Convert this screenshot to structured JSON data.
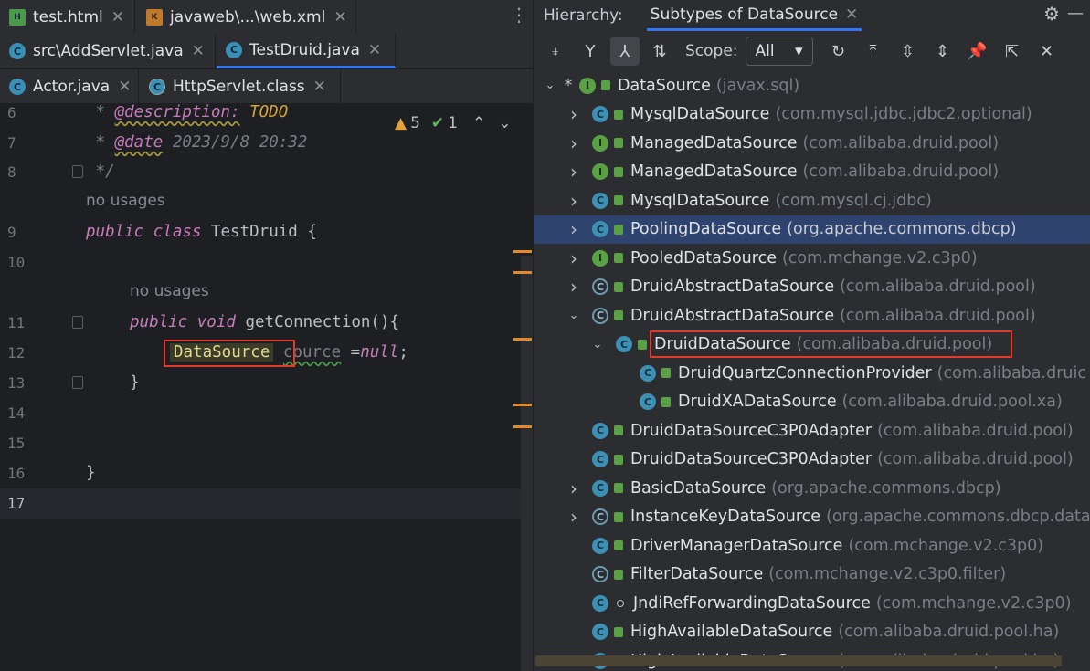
{
  "editor": {
    "tab_rows": [
      [
        {
          "label": "test.html",
          "icon": "html-file-icon"
        },
        {
          "label": "javaweb\\...\\web.xml",
          "icon": "xml-file-icon"
        }
      ],
      [
        {
          "label": "src\\AddServlet.java",
          "icon": "java-class-icon"
        },
        {
          "label": "TestDruid.java",
          "icon": "java-class-icon",
          "active": true
        }
      ],
      [
        {
          "label": "Actor.java",
          "icon": "java-class-icon"
        },
        {
          "label": "HttpServlet.class",
          "icon": "compiled-class-icon"
        }
      ]
    ],
    "inspection": {
      "warnings": "5",
      "weak_warnings": "1"
    },
    "lines": {
      "n6": "6",
      "n7": "7",
      "n8": "8",
      "n9": "9",
      "n10": "10",
      "n11": "11",
      "n12": "12",
      "n13": "13",
      "n14": "14",
      "n15": "15",
      "n16": "16",
      "n17": "17"
    },
    "code": {
      "l6_star": " * ",
      "l6_tag": "@description:",
      "l6_todo": " TODO",
      "l7_star": " * ",
      "l7_tag": "@date",
      "l7_rest": " 2023/9/8 20:32",
      "l8": " */",
      "usage1": "no usages",
      "l9_public": "public",
      "l9_class": "class",
      "l9_rest": " TestDruid {",
      "usage2": "no usages",
      "l11_public": "public",
      "l11_void": "void",
      "l11_rest": " getConnection(){",
      "l12_type": "DataSource",
      "l12_var": "cource",
      "l12_eq": " =",
      "l12_null": "null",
      "l12_end": ";",
      "l13": "}",
      "l16": "}"
    }
  },
  "hierarchy": {
    "title": "Hierarchy:",
    "tab": "Subtypes of DataSource",
    "scope_label": "Scope:",
    "scope_value": "All",
    "nodes": [
      {
        "name": "DataSource",
        "pkg": "(javax.sql)",
        "icon": "interface-icon",
        "depth": 0,
        "arrow": "down",
        "star": "*"
      },
      {
        "name": "MysqlDataSource",
        "pkg": "(com.mysql.jdbc.jdbc2.optional)",
        "icon": "class-icon",
        "depth": 1,
        "arrow": "right"
      },
      {
        "name": "ManagedDataSource",
        "pkg": "(com.alibaba.druid.pool)",
        "icon": "interface-icon",
        "depth": 1,
        "arrow": "right"
      },
      {
        "name": "ManagedDataSource",
        "pkg": "(com.alibaba.druid.pool)",
        "icon": "interface-icon",
        "depth": 1,
        "arrow": "right"
      },
      {
        "name": "MysqlDataSource",
        "pkg": "(com.mysql.cj.jdbc)",
        "icon": "class-icon",
        "depth": 1,
        "arrow": "right"
      },
      {
        "name": "PoolingDataSource",
        "pkg": "(org.apache.commons.dbcp)",
        "icon": "class-icon",
        "depth": 1,
        "arrow": "right",
        "selected": true
      },
      {
        "name": "PooledDataSource",
        "pkg": "(com.mchange.v2.c3p0)",
        "icon": "interface-icon",
        "depth": 1,
        "arrow": "right"
      },
      {
        "name": "DruidAbstractDataSource",
        "pkg": "(com.alibaba.druid.pool)",
        "icon": "abstract-class-icon",
        "depth": 1,
        "arrow": "right"
      },
      {
        "name": "DruidAbstractDataSource",
        "pkg": "(com.alibaba.druid.pool)",
        "icon": "abstract-class-icon",
        "depth": 1,
        "arrow": "down"
      },
      {
        "name": "DruidDataSource",
        "pkg": "(com.alibaba.druid.pool)",
        "icon": "class-icon",
        "depth": 2,
        "arrow": "down",
        "boxed": true
      },
      {
        "name": "DruidQuartzConnectionProvider",
        "pkg": "(com.alibaba.druic",
        "icon": "class-icon",
        "depth": 3,
        "arrow": ""
      },
      {
        "name": "DruidXADataSource",
        "pkg": "(com.alibaba.druid.pool.xa)",
        "icon": "class-icon",
        "depth": 3,
        "arrow": ""
      },
      {
        "name": "DruidDataSourceC3P0Adapter",
        "pkg": "(com.alibaba.druid.pool)",
        "icon": "class-icon",
        "depth": 1,
        "arrow": ""
      },
      {
        "name": "DruidDataSourceC3P0Adapter",
        "pkg": "(com.alibaba.druid.pool)",
        "icon": "class-icon",
        "depth": 1,
        "arrow": ""
      },
      {
        "name": "BasicDataSource",
        "pkg": "(org.apache.commons.dbcp)",
        "icon": "class-icon",
        "depth": 1,
        "arrow": "right"
      },
      {
        "name": "InstanceKeyDataSource",
        "pkg": "(org.apache.commons.dbcp.datas",
        "icon": "abstract-class-icon",
        "depth": 1,
        "arrow": "right"
      },
      {
        "name": "DriverManagerDataSource",
        "pkg": "(com.mchange.v2.c3p0)",
        "icon": "class-icon",
        "depth": 1,
        "arrow": ""
      },
      {
        "name": "FilterDataSource",
        "pkg": "(com.mchange.v2.c3p0.filter)",
        "icon": "abstract-class-icon",
        "depth": 1,
        "arrow": ""
      },
      {
        "name": "JndiRefForwardingDataSource",
        "pkg": "(com.mchange.v2.c3p0)",
        "icon": "class-icon",
        "depth": 1,
        "arrow": "",
        "dot": true
      },
      {
        "name": "HighAvailableDataSource",
        "pkg": "(com.alibaba.druid.pool.ha)",
        "icon": "class-icon",
        "depth": 1,
        "arrow": ""
      },
      {
        "name": "HighAvailableDataSource",
        "pkg": "(com.alibaba.druid.pool.ha)",
        "icon": "class-icon",
        "depth": 1,
        "arrow": ""
      }
    ]
  }
}
